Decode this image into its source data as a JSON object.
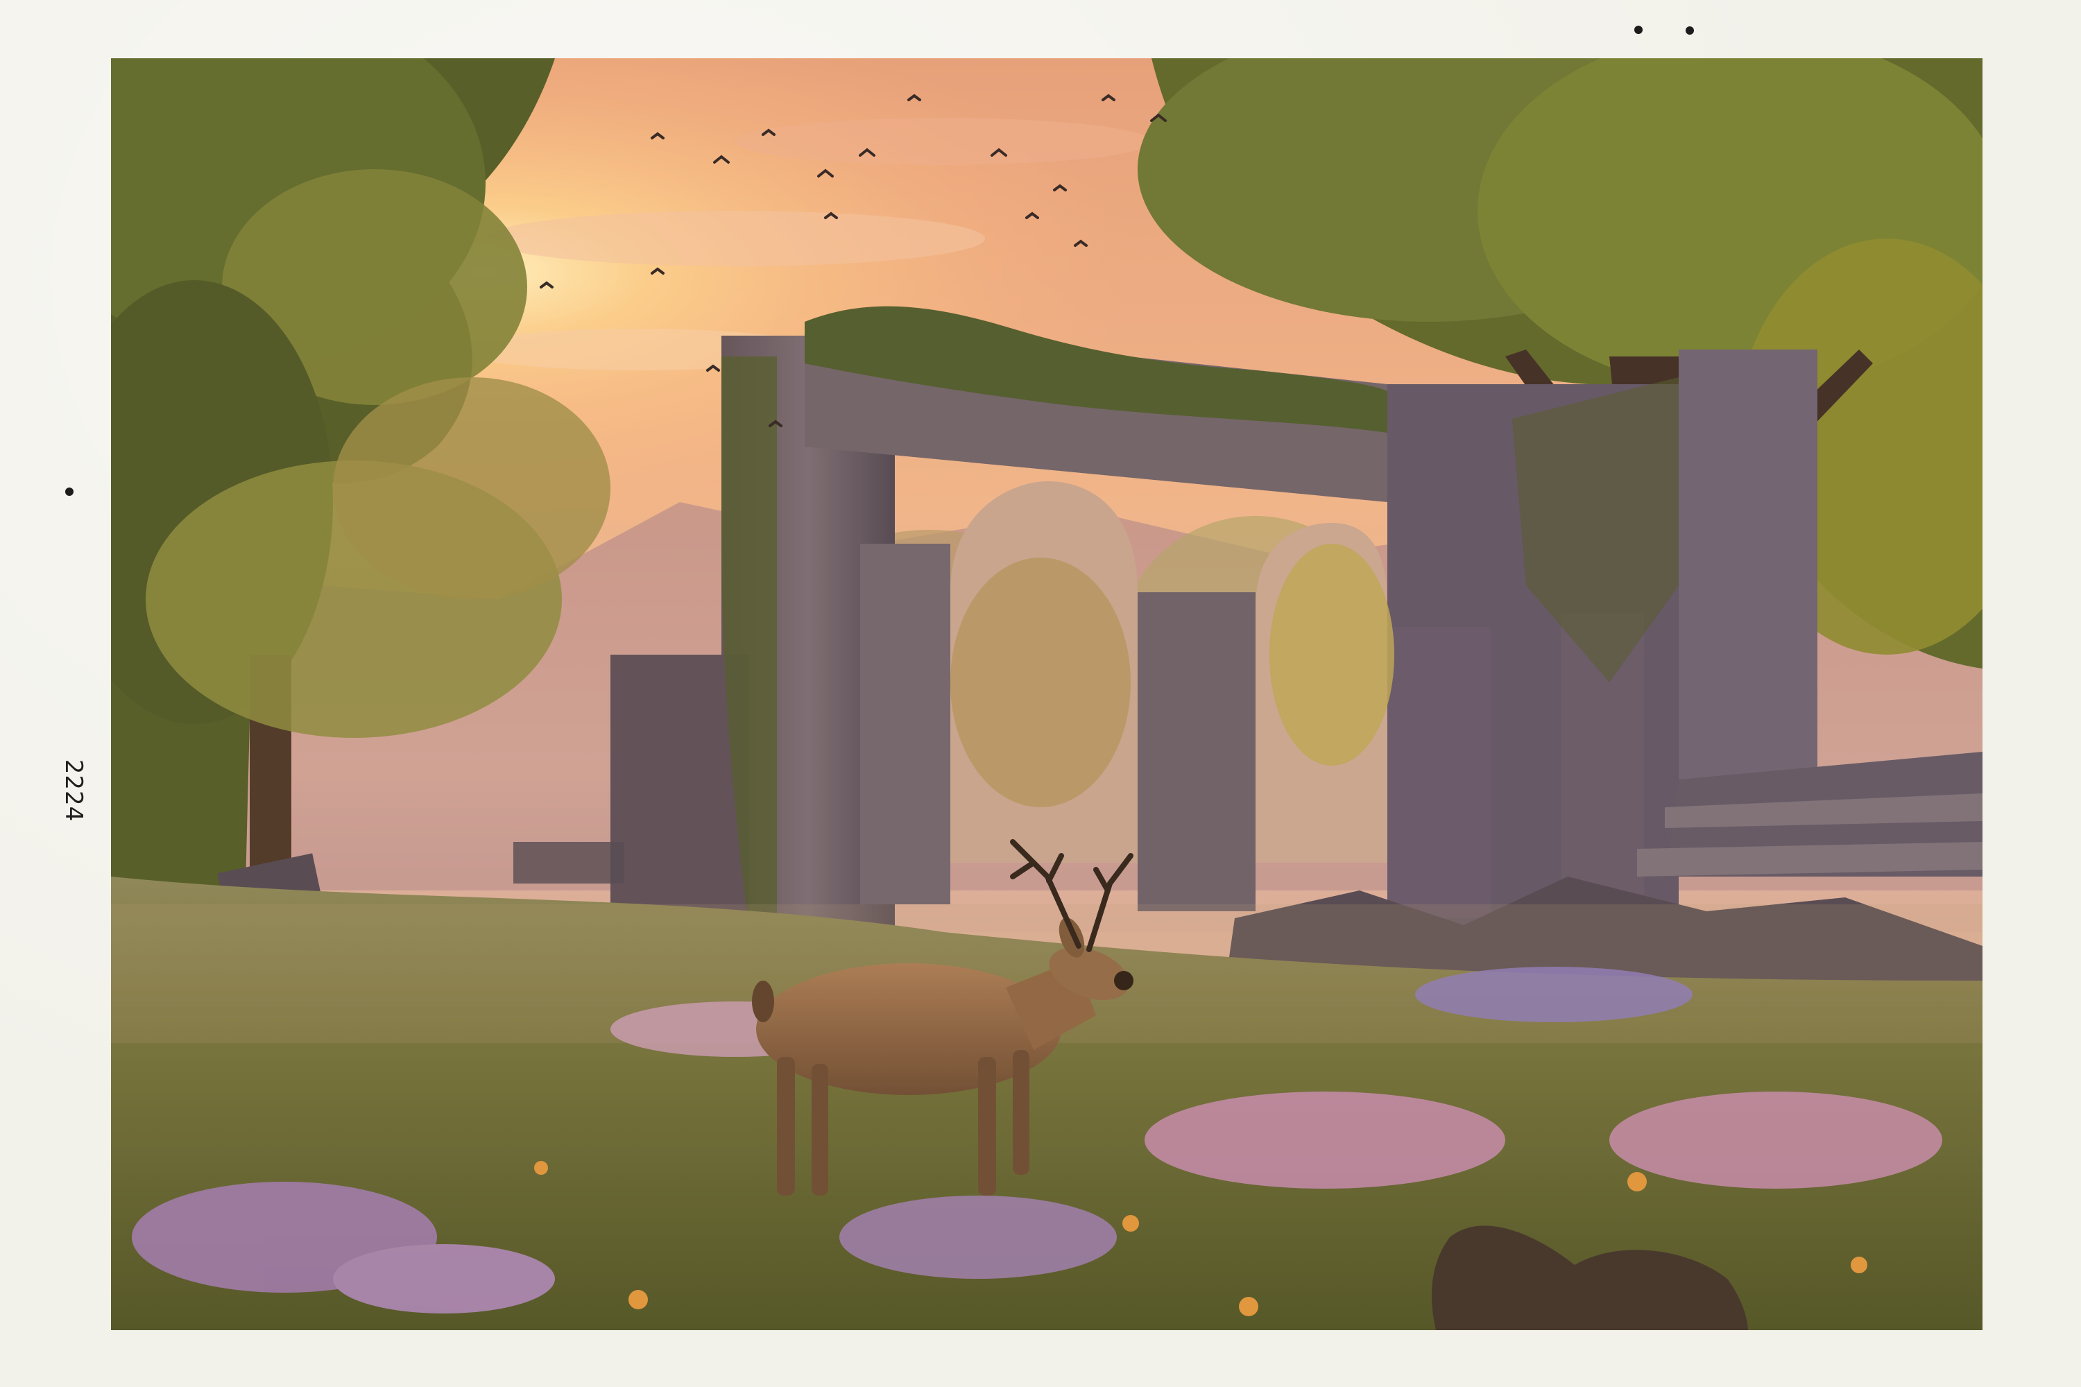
{
  "print": {
    "side_number": "2224"
  }
}
